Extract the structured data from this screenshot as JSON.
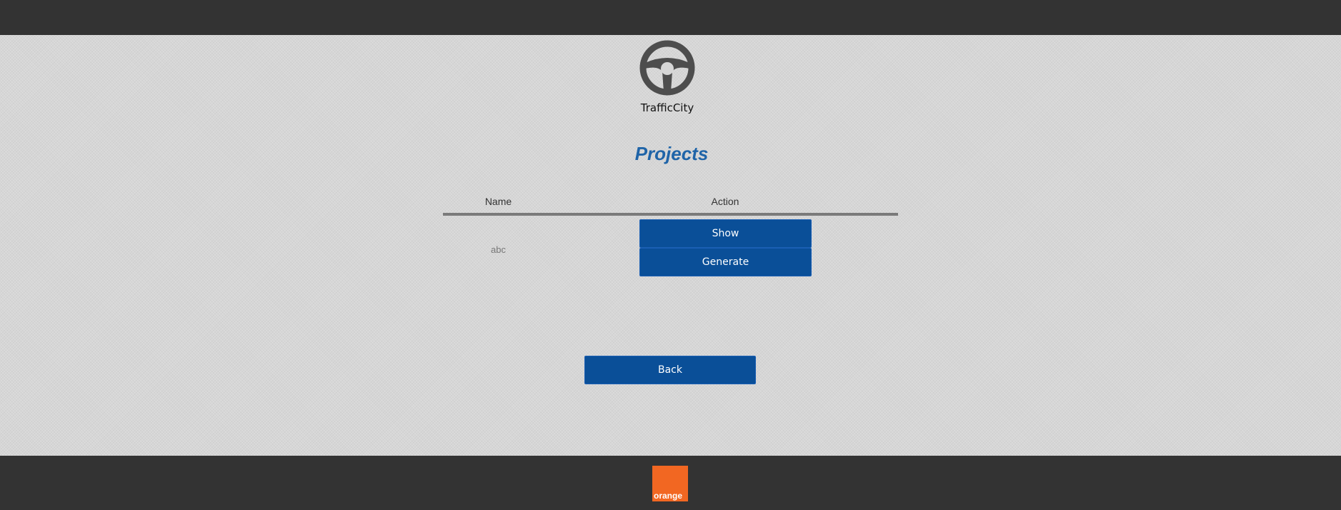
{
  "brand": {
    "name": "TrafficCity",
    "logo_icon": "steering-wheel-icon"
  },
  "page": {
    "title": "Projects"
  },
  "table": {
    "headers": [
      "Name",
      "Action"
    ],
    "rows": [
      {
        "name": "abc",
        "actions": [
          "Show",
          "Generate"
        ]
      }
    ]
  },
  "buttons": {
    "back_label": "Back"
  },
  "footer": {
    "logo_text": "orange"
  },
  "colors": {
    "bar": "#333333",
    "background": "#d6d6d6",
    "button": "#0a4f98",
    "title": "#1f64a8",
    "footer_logo": "#f26722"
  }
}
